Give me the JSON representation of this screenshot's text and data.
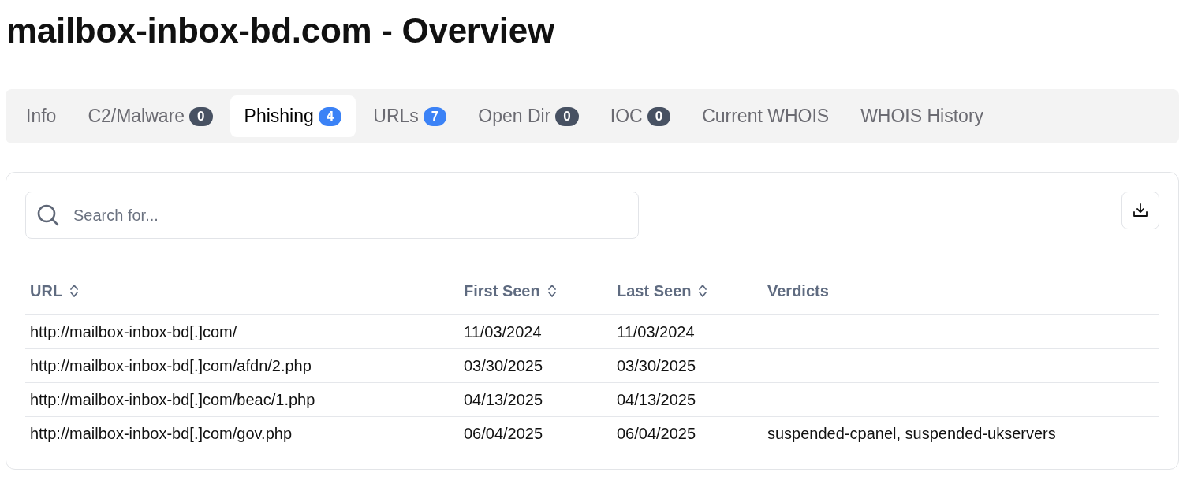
{
  "title": "mailbox-inbox-bd.com - Overview",
  "tabs": [
    {
      "label": "Info",
      "selected": false
    },
    {
      "label": "C2/Malware",
      "selected": false,
      "badge": {
        "text": "0",
        "color": "#475162"
      }
    },
    {
      "label": "Phishing",
      "selected": true,
      "badge": {
        "text": "4",
        "color": "#3b82f6"
      }
    },
    {
      "label": "URLs",
      "selected": false,
      "badge": {
        "text": "7",
        "color": "#3b82f6"
      }
    },
    {
      "label": "Open Dir",
      "selected": false,
      "badge": {
        "text": "0",
        "color": "#475162"
      }
    },
    {
      "label": "IOC",
      "selected": false,
      "badge": {
        "text": "0",
        "color": "#475162"
      }
    },
    {
      "label": "Current WHOIS",
      "selected": false
    },
    {
      "label": "WHOIS History",
      "selected": false
    }
  ],
  "search": {
    "placeholder": "Search for..."
  },
  "table": {
    "columns": [
      {
        "label": "URL",
        "sortable": true
      },
      {
        "label": "First Seen",
        "sortable": true
      },
      {
        "label": "Last Seen",
        "sortable": true
      },
      {
        "label": "Verdicts",
        "sortable": false
      }
    ],
    "rows": [
      [
        "http://mailbox-inbox-bd[.]com/",
        "11/03/2024",
        "11/03/2024",
        ""
      ],
      [
        "http://mailbox-inbox-bd[.]com/afdn/2.php",
        "03/30/2025",
        "03/30/2025",
        ""
      ],
      [
        "http://mailbox-inbox-bd[.]com/beac/1.php",
        "04/13/2025",
        "04/13/2025",
        ""
      ],
      [
        "http://mailbox-inbox-bd[.]com/gov.php",
        "06/04/2025",
        "06/04/2025",
        "suspended-cpanel, suspended-ukservers"
      ]
    ]
  }
}
